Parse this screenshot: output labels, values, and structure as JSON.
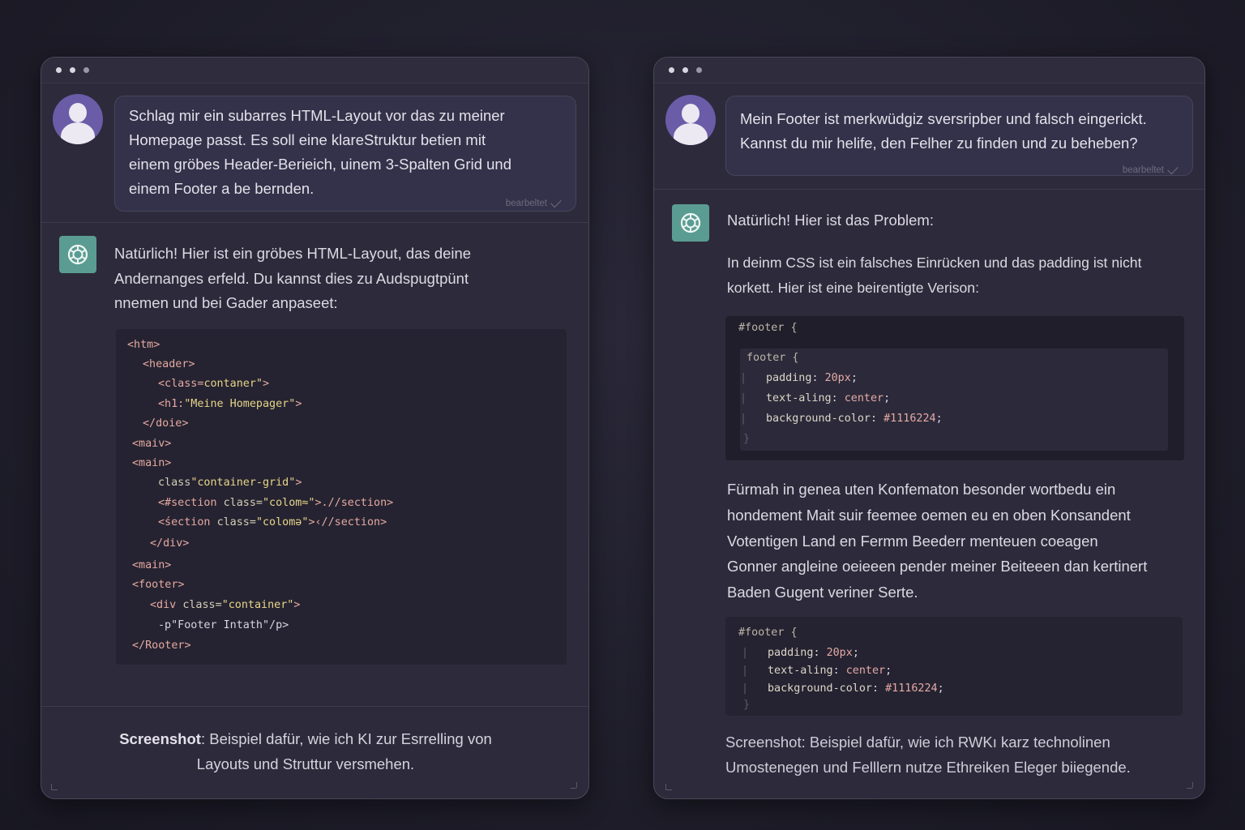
{
  "left": {
    "user_message": "Schlag mir ein subarres HTML-Layout vor das zu meiner\nHomepage passt. Es soll eine klareStruktur betien mit\neinem gröbes Header-Berieich, uinem 3-Spalten Grid und\neinem Footer a be bernden.",
    "edited_label": "bearbeltet",
    "ai_message": "Natürlich! Hier ist ein gröbes HTML-Layout, das deine\nAndernanges erfeld. Du kannst dies zu Audspugtpünt\nnnemen und bei Gader anpaseet:",
    "code": [
      {
        "tag": "<htm>",
        "rest": ""
      },
      {
        "tag": "<header>",
        "rest": ""
      },
      {
        "tag": "<class=",
        "str": "contaner\"",
        "tag2": ">"
      },
      {
        "tag": "<h1:",
        "str": "\"Meine Homepager\"",
        "tag2": ">"
      },
      {
        "tag": "</doie>",
        "rest": ""
      },
      {
        "tag": "<maiv>",
        "rest": ""
      },
      {
        "tag": "<main>",
        "rest": ""
      },
      {
        "attr": "class",
        "str": "\"container-grid\"",
        "tag2": ">"
      },
      {
        "tag": "<#section ",
        "attr": "class=",
        "str": "\"colom≈\"",
        "tag2": ">.//section>"
      },
      {
        "tag": "<śection ",
        "attr": "class=",
        "str": "\"colomə\"",
        "tag2": ">‹//section>"
      },
      {
        "tag": "</div>",
        "rest": ""
      },
      {
        "tag": "<main>",
        "rest": ""
      },
      {
        "tag": "<footer>",
        "rest": ""
      },
      {
        "tag": "<div ",
        "attr": "class=",
        "str": "\"container\"",
        "tag2": ">"
      },
      {
        "plain": "-p\"Footer Intath\"/p>"
      },
      {
        "tag": "</Rooter>",
        "rest": ""
      }
    ],
    "caption_bold": "Screenshot",
    "caption_line1": ": Beispiel dafür, wie ich KI zur Esrrelling von",
    "caption_line2": "Layouts und Struttur versmehen."
  },
  "right": {
    "user_message": "Mein Footer ist merkwüdgiz sversripber und falsch eingerickt.\nKannst du mir helife, den Felher zu finden und zu beheben?",
    "edited_label": "bearbeltet",
    "ai_intro": "Natürlich! Hier ist das Problem:",
    "ai_explain": "In deinm CSS ist ein falsches Einrücken und das padding ist nicht\nkorkett. Hier ist eine beirentigte Verison:",
    "code1_header": "#footer {",
    "code1_inner_selector": "footer {",
    "code1_lines": [
      {
        "prop": "padding",
        "val": "20px"
      },
      {
        "prop": "text-aling",
        "val": "center"
      },
      {
        "prop": "background-color",
        "val": "#1116224"
      }
    ],
    "close_brace": "}",
    "ai_followup": "Fürmah in genea uten Konfematon besonder wortbedu ein\nhondement Mait suir feemee oemen eu en oben Konsandent\nVotentigen Land en Fermm Beederr menteuen coeagen\nGonner angleine oeieeen pender meiner Beiteeen dan kertinert\nBaden Gugent veriner Serte.",
    "code2_header": "#footer {",
    "code2_lines": [
      {
        "prop": "padding",
        "val": "20px"
      },
      {
        "prop": "text-aling",
        "val": "center"
      },
      {
        "prop": "background-color",
        "val": "#1116224"
      }
    ],
    "caption_line1": "Screenshot: Beispiel dafür, wie ich RWKı karz technolinen",
    "caption_line2": "Umostenegen und Felllern nutze Ethreiken Eleger biiegende."
  }
}
